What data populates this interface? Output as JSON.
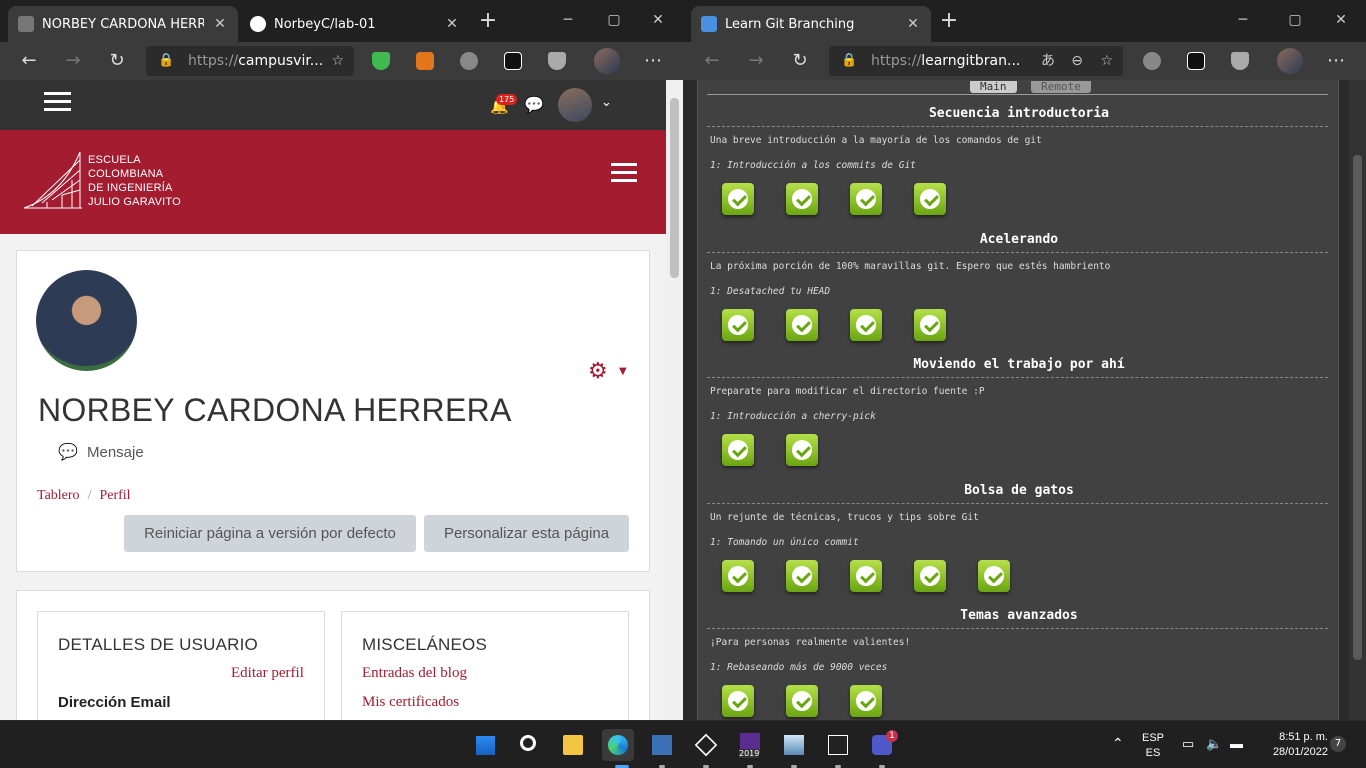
{
  "left_window": {
    "tabs": [
      {
        "label": "NORBEY CARDONA HERRERA:",
        "active": true
      },
      {
        "label": "NorbeyC/lab-01",
        "active": false
      }
    ],
    "close_glyph": "✕",
    "new_tab_glyph": "+",
    "address": {
      "prefix": "https://",
      "host": "campusvir..."
    },
    "page": {
      "notification_count": "175",
      "logo_text": [
        "ESCUELA",
        "COLOMBIANA",
        "DE INGENIERÍA",
        "JULIO GARAVITO"
      ],
      "profile_name": "NORBEY CARDONA HERRERA",
      "message_label": "Mensaje",
      "breadcrumb": [
        "Tablero",
        "Perfil"
      ],
      "breadcrumb_sep": "/",
      "buttons": [
        "Reiniciar página a versión por defecto",
        "Personalizar esta página"
      ],
      "details": {
        "title": "DETALLES DE USUARIO",
        "edit_link": "Editar perfil",
        "email_label": "Dirección Email"
      },
      "misc": {
        "title": "MISCELÁNEOS",
        "links": [
          "Entradas del blog",
          "Mis certificados"
        ]
      }
    }
  },
  "right_window": {
    "tabs": [
      {
        "label": "Learn Git Branching",
        "active": true
      }
    ],
    "address": {
      "prefix": "https://",
      "host": "learngitbran..."
    },
    "top_tabs": [
      "Main",
      "Remote"
    ],
    "levels": [
      {
        "title": "Secuencia introductoria",
        "desc": "Una breve introducción a la mayoría de los comandos de git",
        "sub": "1: Introducción a los commits de Git",
        "completed": 4
      },
      {
        "title": "Acelerando",
        "desc": "La próxima porción de 100% maravillas git. Espero que estés hambriento",
        "sub": "1: Desatached tu HEAD",
        "completed": 4
      },
      {
        "title": "Moviendo el trabajo por ahí",
        "desc": "Preparate para modificar el directorio fuente :P",
        "sub": "1: Introducción a cherry-pick",
        "completed": 2
      },
      {
        "title": "Bolsa de gatos",
        "desc": "Un rejunte de técnicas, trucos y tips sobre Git",
        "sub": "1: Tomando un único commit",
        "completed": 5
      },
      {
        "title": "Temas avanzados",
        "desc": "¡Para personas realmente valientes!",
        "sub": "1: Rebaseando más de 9000 veces",
        "completed": 3
      }
    ]
  },
  "taskbar": {
    "language": [
      "ESP",
      "ES"
    ],
    "time": "8:51 p. m.",
    "date": "28/01/2022",
    "notification_count": "7",
    "teams_badge": "1",
    "vs_label": "2019"
  },
  "colors": {
    "brand_red": "#a41c30",
    "check_green": "#6aa512"
  }
}
